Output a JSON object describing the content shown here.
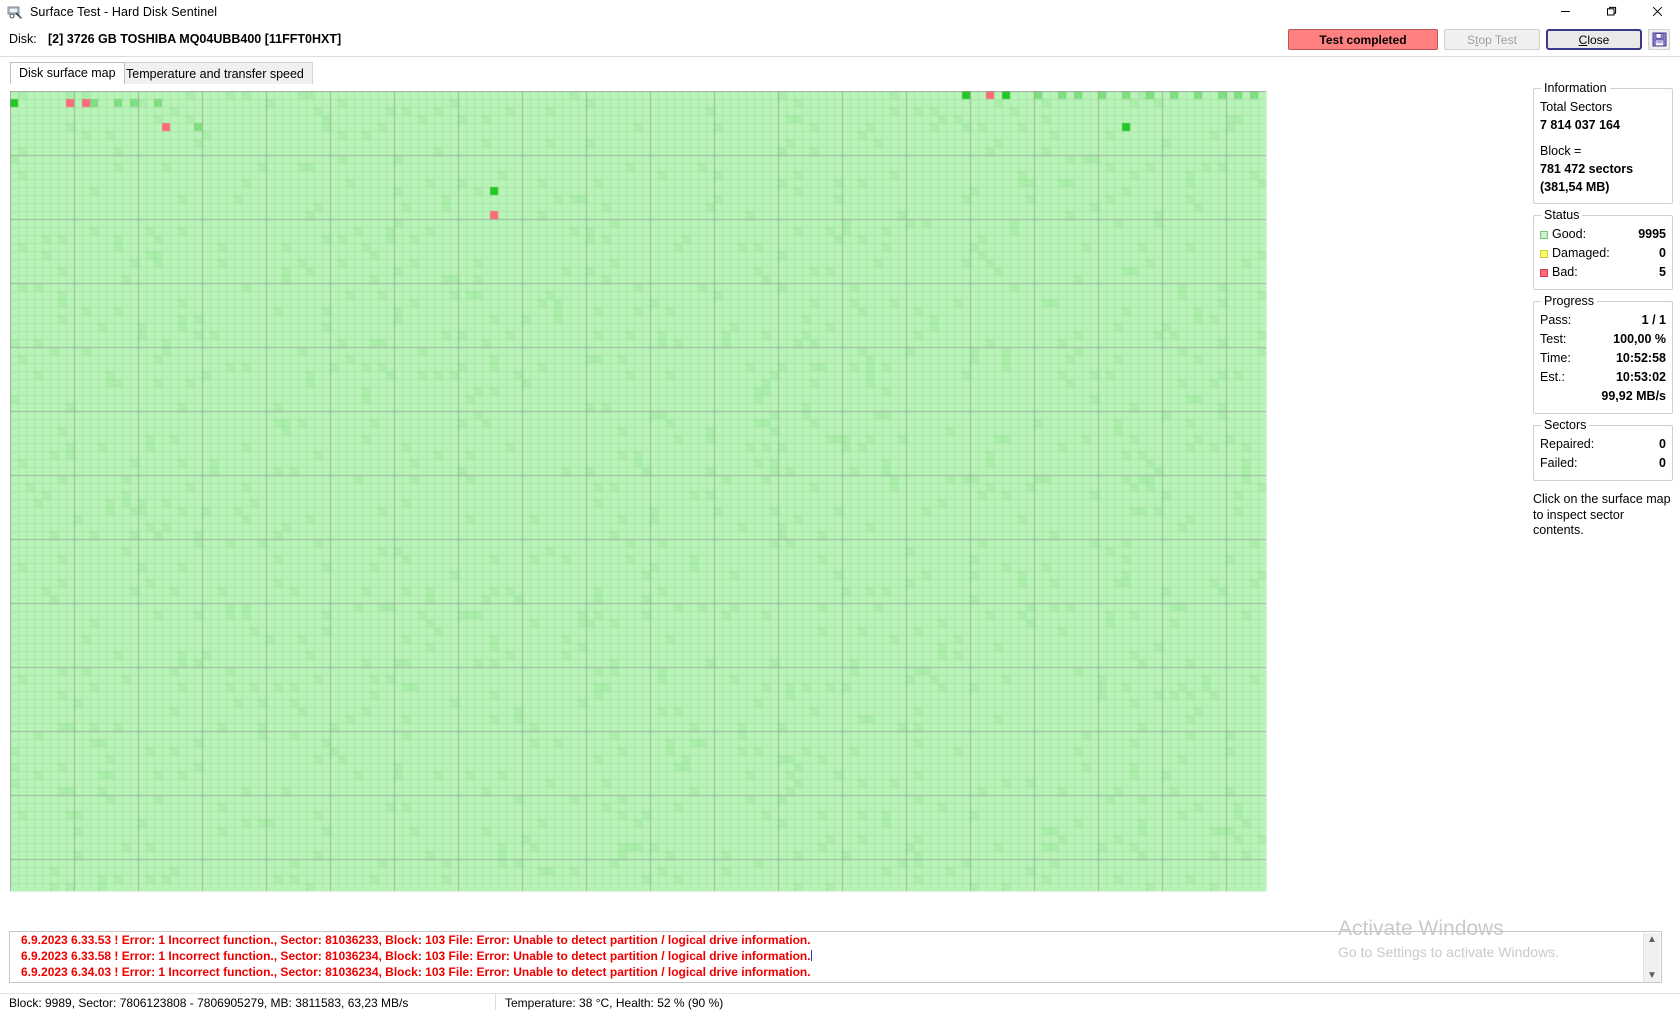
{
  "window": {
    "title": "Surface Test - Hard Disk Sentinel",
    "icon": "disk-surface-icon",
    "controls": {
      "minimize": "—",
      "maximize": "❐",
      "close": "✕"
    }
  },
  "disk": {
    "label": "Disk:",
    "value": "[2] 3726 GB  TOSHIBA MQ04UBB400 [11FFT0HXT]"
  },
  "toolbar": {
    "test_status": "Test completed",
    "test_status_color": "#ff8080",
    "stop_label_pre": "S",
    "stop_label_accel": "t",
    "stop_label_post": "op Test",
    "close_label_accel": "C",
    "close_label_post": "lose",
    "save_icon": "floppy-save-icon"
  },
  "tabs": [
    {
      "label": "Disk surface map",
      "active": true
    },
    {
      "label": "Temperature and transfer speed",
      "active": false
    }
  ],
  "information": {
    "title": "Information",
    "total_sectors_label": "Total Sectors",
    "total_sectors_value": "7 814 037 164",
    "block_label": "Block =",
    "block_value": "781 472 sectors",
    "block_size": "(381,54 MB)"
  },
  "status": {
    "title": "Status",
    "rows": [
      {
        "label": "Good:",
        "value": "9995",
        "swatch": "sw-good"
      },
      {
        "label": "Damaged:",
        "value": "0",
        "swatch": "sw-damaged"
      },
      {
        "label": "Bad:",
        "value": "5",
        "swatch": "sw-bad"
      }
    ]
  },
  "progress": {
    "title": "Progress",
    "rows": [
      {
        "label": "Pass:",
        "value": "1 / 1"
      },
      {
        "label": "Test:",
        "value": "100,00 %"
      },
      {
        "label": "Time:",
        "value": "10:52:58"
      },
      {
        "label": "Est.:",
        "value": "10:53:02"
      }
    ],
    "speed": "99,92 MB/s"
  },
  "sectors": {
    "title": "Sectors",
    "rows": [
      {
        "label": "Repaired:",
        "value": "0"
      },
      {
        "label": "Failed:",
        "value": "0"
      }
    ]
  },
  "hint": "Click on the surface map to inspect sector contents.",
  "log": {
    "lines": [
      "6.9.2023  6.33.53 ! Error: 1 Incorrect function., Sector: 81036233, Block: 103  File: Error: Unable to detect partition / logical drive information.",
      "6.9.2023  6.33.58 ! Error: 1 Incorrect function., Sector: 81036234, Block: 103  File: Error: Unable to detect partition / logical drive information.",
      "6.9.2023  6.34.03 ! Error: 1 Incorrect function., Sector: 81036234, Block: 103  File: Error: Unable to detect partition / logical drive information."
    ],
    "color": "#ee0000",
    "scroll_up": "▲",
    "scroll_down": "▼"
  },
  "statusbar": {
    "left": "Block: 9989, Sector: 7806123808 - 7806905279, MB: 3811583, 63,23 MB/s",
    "right": "Temperature: 38  °C,  Health: 52 % (90 %)"
  },
  "watermark": {
    "line1": "Activate Windows",
    "line2": "Go to Settings to activate Windows."
  },
  "surface_map": {
    "cols": 157,
    "rows": 100,
    "cell": 8,
    "colors": {
      "good": "#b6f5b6",
      "good_alt": "#a8f0a8",
      "grid": "#9a9a9a",
      "verified": "#22c822",
      "verified_soft": "#7fe07f",
      "bad": "#ff6b7a",
      "bad_soft": "#ff9aa4",
      "background": "#ffffff"
    },
    "marks": [
      {
        "col": 0,
        "row": 1,
        "type": "verified"
      },
      {
        "col": 7,
        "row": 1,
        "type": "bad"
      },
      {
        "col": 9,
        "row": 1,
        "type": "bad"
      },
      {
        "col": 10,
        "row": 1,
        "type": "verified_soft"
      },
      {
        "col": 13,
        "row": 1,
        "type": "verified_soft"
      },
      {
        "col": 15,
        "row": 1,
        "type": "verified_soft"
      },
      {
        "col": 18,
        "row": 1,
        "type": "verified_soft"
      },
      {
        "col": 19,
        "row": 4,
        "type": "bad"
      },
      {
        "col": 23,
        "row": 4,
        "type": "verified_soft"
      },
      {
        "col": 60,
        "row": 12,
        "type": "verified"
      },
      {
        "col": 60,
        "row": 15,
        "type": "bad"
      },
      {
        "col": 119,
        "row": 0,
        "type": "verified"
      },
      {
        "col": 122,
        "row": 0,
        "type": "bad"
      },
      {
        "col": 124,
        "row": 0,
        "type": "verified"
      },
      {
        "col": 128,
        "row": 0,
        "type": "verified_soft"
      },
      {
        "col": 131,
        "row": 0,
        "type": "verified_soft"
      },
      {
        "col": 133,
        "row": 0,
        "type": "verified_soft"
      },
      {
        "col": 136,
        "row": 0,
        "type": "verified_soft"
      },
      {
        "col": 139,
        "row": 0,
        "type": "verified_soft"
      },
      {
        "col": 142,
        "row": 0,
        "type": "verified_soft"
      },
      {
        "col": 145,
        "row": 0,
        "type": "verified_soft"
      },
      {
        "col": 148,
        "row": 0,
        "type": "verified_soft"
      },
      {
        "col": 151,
        "row": 0,
        "type": "verified_soft"
      },
      {
        "col": 153,
        "row": 0,
        "type": "verified_soft"
      },
      {
        "col": 155,
        "row": 0,
        "type": "verified_soft"
      },
      {
        "col": 139,
        "row": 4,
        "type": "verified"
      }
    ]
  }
}
